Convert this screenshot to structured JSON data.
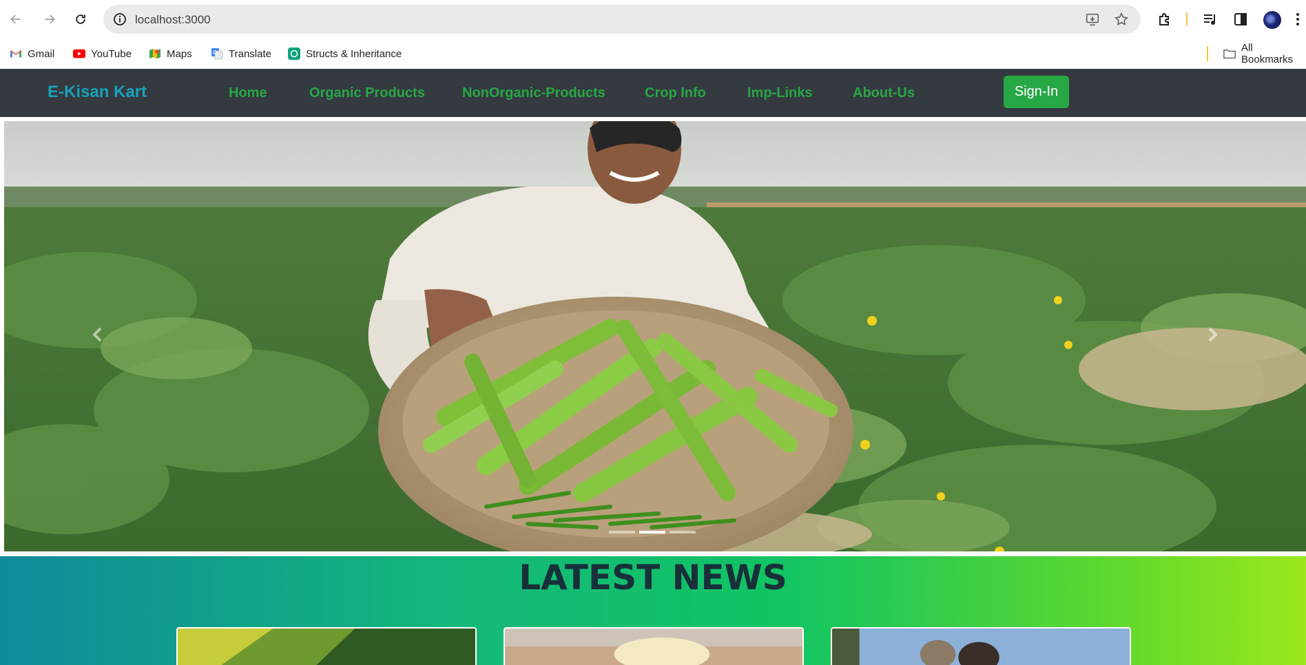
{
  "browser": {
    "url": "localhost:3000",
    "icons": {
      "back": "back-arrow-icon",
      "forward": "forward-arrow-icon",
      "reload": "reload-icon",
      "site_info": "site-info-icon",
      "install": "install-app-icon",
      "bookmark": "bookmark-star-icon",
      "extensions": "extensions-icon",
      "media": "media-controls-icon",
      "side_panel": "side-panel-icon",
      "menu": "kebab-menu-icon"
    }
  },
  "bookmarks": {
    "items": [
      {
        "label": "Gmail",
        "icon": "gmail-icon"
      },
      {
        "label": "YouTube",
        "icon": "youtube-icon"
      },
      {
        "label": "Maps",
        "icon": "maps-icon"
      },
      {
        "label": "Translate",
        "icon": "translate-icon"
      },
      {
        "label": "Structs & Inheritance",
        "icon": "chatgpt-icon"
      }
    ],
    "all_bookmarks": "All Bookmarks"
  },
  "site": {
    "brand": "E-Kisan Kart",
    "nav": [
      "Home",
      "Organic Products",
      "NonOrganic-Products",
      "Crop Info",
      "Imp-Links",
      "About-Us"
    ],
    "signin": "Sign-In",
    "colors": {
      "navbar": "#343a40",
      "brand": "#17a2b8",
      "links": "#28a745",
      "signin": "#28a745"
    }
  },
  "carousel": {
    "slide_count": 3,
    "active_index": 1,
    "prev_icon": "chevron-left-icon",
    "next_icon": "chevron-right-icon"
  },
  "news": {
    "title": "LATEST NEWS",
    "cards": 3
  }
}
